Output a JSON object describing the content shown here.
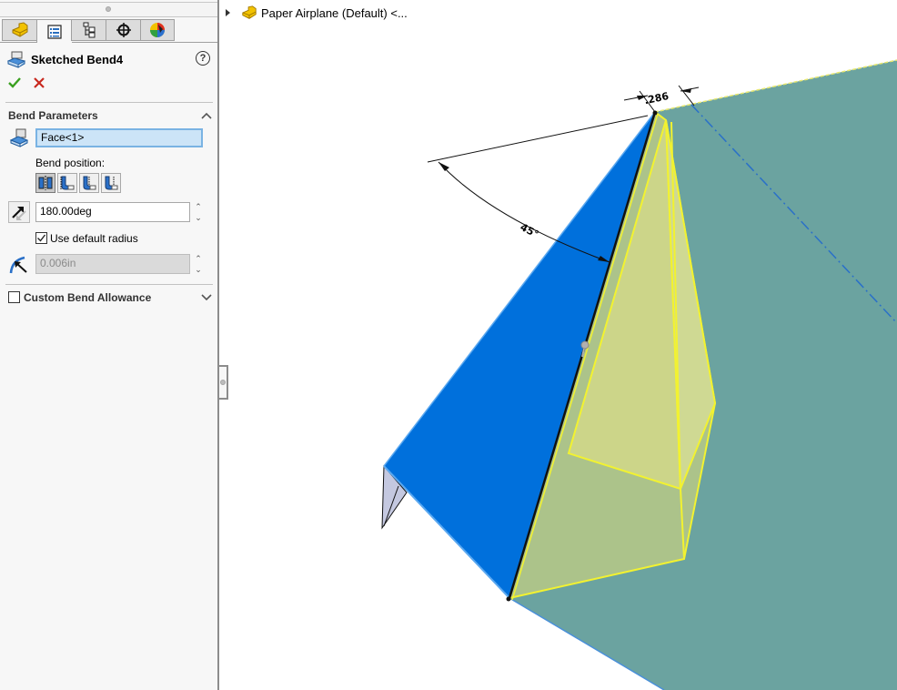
{
  "property_manager": {
    "tabs": [
      {
        "name": "featuremanager-tab",
        "icon": "part-icon"
      },
      {
        "name": "propertymanager-tab",
        "icon": "property-list-icon",
        "active": true
      },
      {
        "name": "configurationmanager-tab",
        "icon": "configuration-tree-icon"
      },
      {
        "name": "dimxpertmanager-tab",
        "icon": "crosshair-icon"
      },
      {
        "name": "displaymanager-tab",
        "icon": "appearance-sphere-icon"
      }
    ],
    "title": "Sketched Bend4",
    "help_label": "?",
    "ok_icon": "checkmark-icon",
    "cancel_icon": "close-icon",
    "bend_parameters": {
      "section_title": "Bend Parameters",
      "fixed_face_value": "Face<1>",
      "bend_position_label": "Bend position:",
      "bend_positions": [
        {
          "name": "bend-centerline",
          "active": true
        },
        {
          "name": "material-inside",
          "active": false
        },
        {
          "name": "material-outside",
          "active": false
        },
        {
          "name": "bend-outside",
          "active": false
        }
      ],
      "bend_angle_value": "180.00deg",
      "use_default_radius_label": "Use default radius",
      "use_default_radius_checked": true,
      "bend_radius_value": "0.006in"
    },
    "custom_bend_allowance": {
      "label": "Custom Bend Allowance",
      "checked": false
    }
  },
  "feature_tree": {
    "root_label": "Paper Airplane (Default) <..."
  },
  "viewport": {
    "dimension_width_label": ".286",
    "dimension_angle_label": "45°",
    "colors": {
      "blue_face": "#0070dc",
      "teal_face": "#6ba3a0",
      "yellow_highlight": "#f2f230",
      "preview_fill": "#c8d080"
    }
  }
}
